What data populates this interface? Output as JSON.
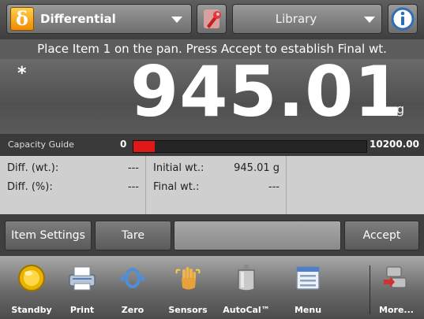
{
  "header": {
    "mode_label": "Differential",
    "mode_icon_glyph": "δ",
    "mode_icon": "differential-delta-icon",
    "wrench_icon": "wrench-icon",
    "library_label": "Library",
    "info_icon": "info-icon",
    "accent_color": "#f08a00"
  },
  "prompt": "Place Item 1 on the pan. Press Accept to establish Final wt.",
  "readout": {
    "stability_mark": "*",
    "value": "945.01",
    "unit": "g"
  },
  "capacity": {
    "label": "Capacity Guide",
    "min": "0",
    "max": "10200.00",
    "fill_fraction": 0.09,
    "fill_color": "#e01818"
  },
  "data": {
    "diff_wt_label": "Diff. (wt.):",
    "diff_wt_value": "---",
    "diff_pct_label": "Diff. (%):",
    "diff_pct_value": "---",
    "initial_label": "Initial wt.:",
    "initial_value": "945.01 g",
    "final_label": "Final wt.:",
    "final_value": "---"
  },
  "buttons": {
    "item_settings": "Item Settings",
    "tare": "Tare",
    "blank": "",
    "accept": "Accept"
  },
  "dock": [
    {
      "label": "Standby",
      "icon": "standby-icon"
    },
    {
      "label": "Print",
      "icon": "printer-icon"
    },
    {
      "label": "Zero",
      "icon": "zero-icon"
    },
    {
      "label": "Sensors",
      "icon": "sensors-hand-icon"
    },
    {
      "label": "AutoCal™",
      "icon": "calibration-weight-icon"
    },
    {
      "label": "Menu",
      "icon": "menu-icon"
    },
    {
      "label": "More...",
      "icon": "more-icon"
    }
  ]
}
